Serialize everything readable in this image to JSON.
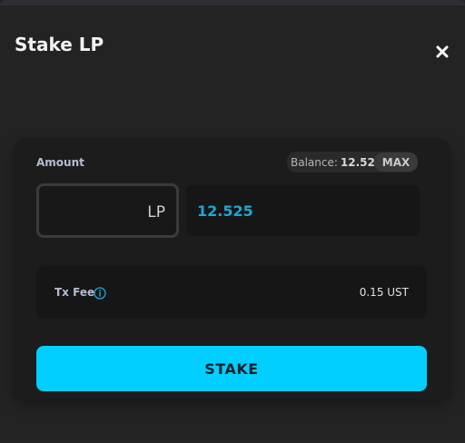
{
  "modal": {
    "title": "Stake LP",
    "close_icon": "close-icon"
  },
  "amount": {
    "label": "Amount",
    "balance_label": "Balance:",
    "balance_value": "12.525",
    "max_label": "MAX",
    "token": "LP",
    "value": "12.525"
  },
  "fee": {
    "label": "Tx Fee",
    "info_icon": "info-icon",
    "value": "0.15 UST"
  },
  "action": {
    "stake_label": "STAKE"
  },
  "colors": {
    "accent": "#00cfff",
    "input_text": "#1ea7d6",
    "background": "#232323",
    "card": "#1c1c1c"
  }
}
